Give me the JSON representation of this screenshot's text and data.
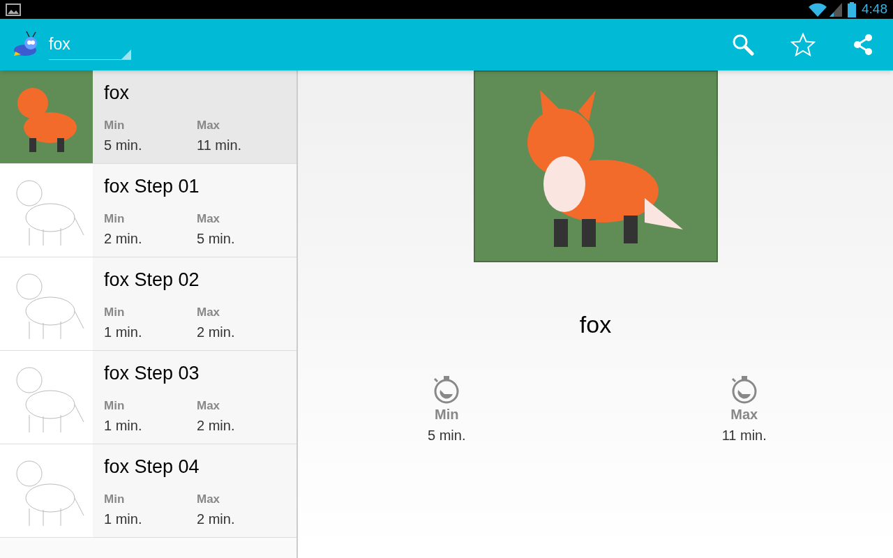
{
  "status_bar": {
    "time": "4:48"
  },
  "action_bar": {
    "title": "fox"
  },
  "list": [
    {
      "title": "fox",
      "kind": "painted",
      "selected": true,
      "min_label": "Min",
      "min": "5 min.",
      "max_label": "Max",
      "max": "11 min."
    },
    {
      "title": "fox Step 01",
      "kind": "sketch",
      "selected": false,
      "min_label": "Min",
      "min": "2 min.",
      "max_label": "Max",
      "max": "5 min."
    },
    {
      "title": "fox Step 02",
      "kind": "sketch",
      "selected": false,
      "min_label": "Min",
      "min": "1 min.",
      "max_label": "Max",
      "max": "2 min."
    },
    {
      "title": "fox Step 03",
      "kind": "sketch",
      "selected": false,
      "min_label": "Min",
      "min": "1 min.",
      "max_label": "Max",
      "max": "2 min."
    },
    {
      "title": "fox Step 04",
      "kind": "sketch",
      "selected": false,
      "min_label": "Min",
      "min": "1 min.",
      "max_label": "Max",
      "max": "2 min."
    }
  ],
  "detail": {
    "title": "fox",
    "stats": [
      {
        "label": "Min",
        "value": "5 min."
      },
      {
        "label": "Max",
        "value": "11 min."
      }
    ]
  }
}
